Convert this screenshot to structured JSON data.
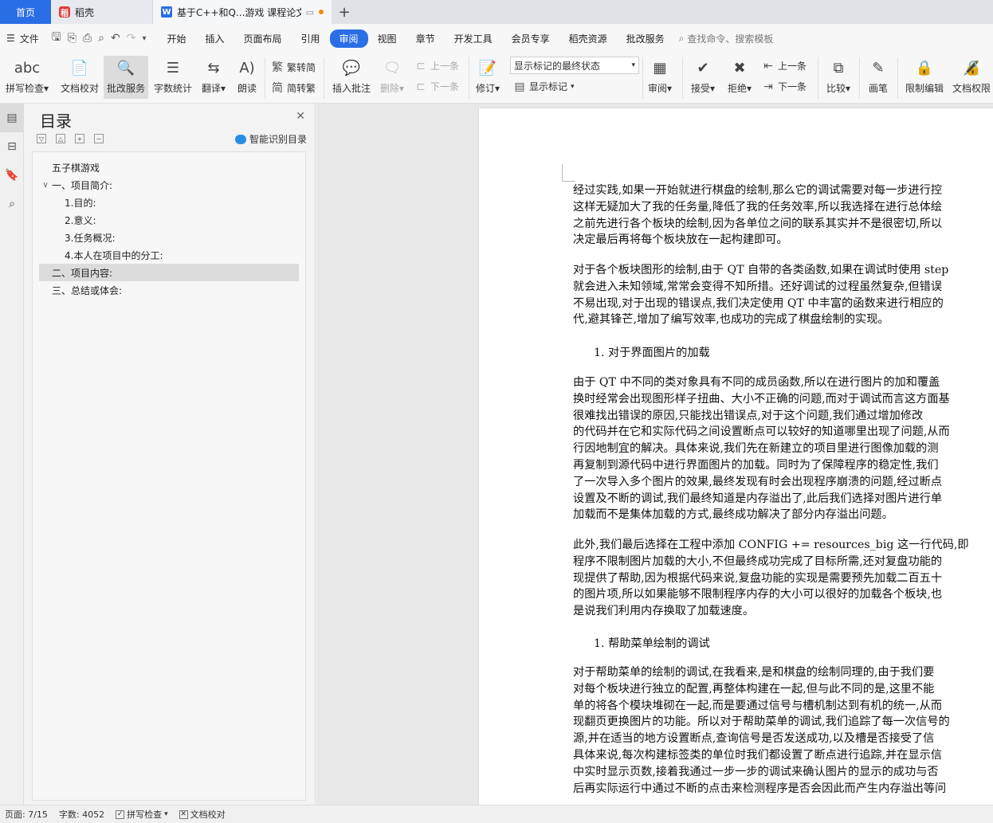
{
  "tabs": {
    "home": "首页",
    "daoke": "稻壳",
    "doc": "基于C++和Q...游戏 课程论文"
  },
  "menubar": {
    "file": "文件",
    "items": [
      "开始",
      "插入",
      "页面布局",
      "引用",
      "审阅",
      "视图",
      "章节",
      "开发工具",
      "会员专享",
      "稻壳资源",
      "批改服务"
    ],
    "active": "审阅",
    "search": "查找命令、搜索模板"
  },
  "ribbon": {
    "spell": "拼写检查",
    "proof": "文档校对",
    "correct": "批改服务",
    "wordcount": "字数统计",
    "translate": "翻译",
    "read": "朗读",
    "trad": "繁转简",
    "simp": "简转繁",
    "insert_comment": "插入批注",
    "delete": "删除",
    "prev_comment": "上一条",
    "next_comment": "下一条",
    "revise": "修订",
    "show_mode": "显示标记的最终状态",
    "show_marks": "显示标记",
    "review": "审阅",
    "accept": "接受",
    "reject": "拒绝",
    "prev": "上一条",
    "next": "下一条",
    "compare": "比较",
    "pen": "画笔",
    "restrict": "限制编辑",
    "permission": "文档权限"
  },
  "outline": {
    "title": "目录",
    "smart": "智能识别目录",
    "items": [
      {
        "text": "五子棋游戏",
        "level": 0
      },
      {
        "text": "一、项目简介:",
        "level": 0,
        "expanded": true
      },
      {
        "text": "1.目的:",
        "level": 1
      },
      {
        "text": "2.意义:",
        "level": 1
      },
      {
        "text": "3.任务概况:",
        "level": 1
      },
      {
        "text": "4.本人在项目中的分工:",
        "level": 1
      },
      {
        "text": "二、项目内容:",
        "level": 0,
        "selected": true
      },
      {
        "text": "三、总结或体会:",
        "level": 0
      }
    ]
  },
  "document": {
    "p1": [
      "经过实践,如果一开始就进行棋盘的绘制,那么它的调试需要对每一步进行控",
      "这样无疑加大了我的任务量,降低了我的任务效率,所以我选择在进行总体绘",
      "之前先进行各个板块的绘制,因为各单位之间的联系其实并不是很密切,所以",
      "决定最后再将每个板块放在一起构建即可。"
    ],
    "p2": [
      "对于各个板块图形的绘制,由于 QT 自带的各类函数,如果在调试时使用 step",
      "就会进入未知领域,常常会变得不知所措。还好调试的过程虽然复杂,但错误",
      "不易出现,对于出现的错误点,我们决定使用 QT 中丰富的函数来进行相应的",
      "代,避其锋芒,增加了编写效率,也成功的完成了棋盘绘制的实现。"
    ],
    "h1": "1.  对于界面图片的加载",
    "p3": [
      "由于 QT 中不同的类对象具有不同的成员函数,所以在进行图片的加和覆盖",
      "换时经常会出现图形样子扭曲、大小不正确的问题,而对于调试而言这方面基",
      "很难找出错误的原因,只能找出错误点,对于这个问题,我们通过增加修改",
      "的代码并在它和实际代码之间设置断点可以较好的知道哪里出现了问题,从而",
      "行因地制宜的解决。具体来说,我们先在新建立的项目里进行图像加载的测",
      "再复制到源代码中进行界面图片的加载。同时为了保障程序的稳定性,我们",
      "了一次导入多个图片的效果,最终发现有时会出现程序崩溃的问题,经过断点",
      "设置及不断的调试,我们最终知道是内存溢出了,此后我们选择对图片进行单",
      "加载而不是集体加载的方式,最终成功解决了部分内存溢出问题。"
    ],
    "p4": [
      "此外,我们最后选择在工程中添加 CONFIG += resources_big 这一行代码,即",
      "程序不限制图片加载的大小,不但最终成功完成了目标所需,还对复盘功能的",
      "现提供了帮助,因为根据代码来说,复盘功能的实现是需要预先加载二百五十",
      "的图片项,所以如果能够不限制程序内存的大小可以很好的加载各个板块,也",
      "是说我们利用内存换取了加载速度。"
    ],
    "h2": "1.  帮助菜单绘制的调试",
    "p5": [
      "对于帮助菜单的绘制的调试,在我看来,是和棋盘的绘制同理的,由于我们要",
      "对每个板块进行独立的配置,再整体构建在一起,但与此不同的是,这里不能",
      "单的将各个模块堆砌在一起,而是要通过信号与槽机制达到有机的统一,从而",
      "现翻页更换图片的功能。所以对于帮助菜单的调试,我们追踪了每一次信号的",
      "源,并在适当的地方设置断点,查询信号是否发送成功,以及槽是否接受了信",
      "具体来说,每次构建标签类的单位时我们都设置了断点进行追踪,并在显示信",
      "中实时显示页数,接着我通过一步一步的调试来确认图片的显示的成功与否",
      "后再实际运行中通过不断的点击来检测程序是否会因此而产生内存溢出等问"
    ]
  },
  "status": {
    "page": "页面: 7/15",
    "words": "字数: 4052",
    "spell": "拼写检查",
    "proof": "文档校对"
  }
}
